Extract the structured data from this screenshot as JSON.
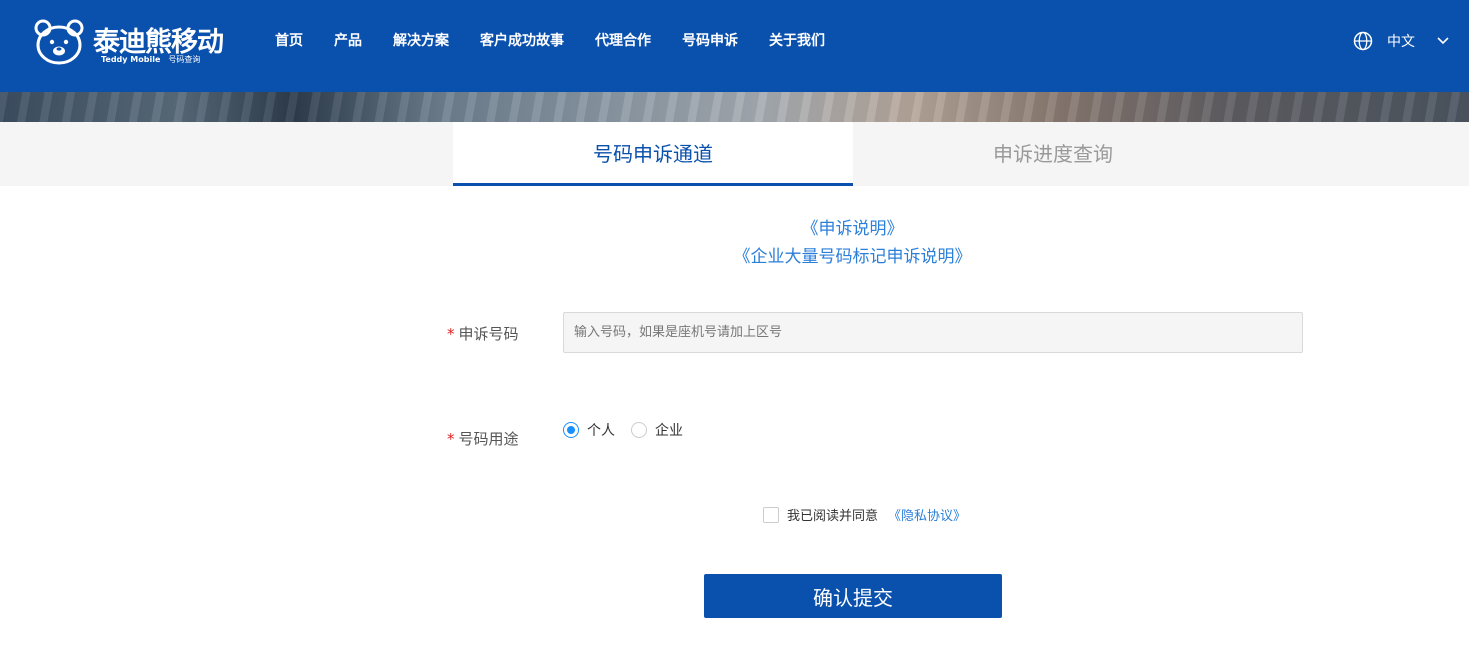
{
  "header": {
    "logo": {
      "cn_text": "泰迪熊移动",
      "en_text": "Teddy Mobile",
      "sub_text": "号码查询"
    },
    "nav": [
      {
        "label": "首页"
      },
      {
        "label": "产品"
      },
      {
        "label": "解决方案"
      },
      {
        "label": "客户成功故事"
      },
      {
        "label": "代理合作"
      },
      {
        "label": "号码申诉"
      },
      {
        "label": "关于我们"
      }
    ],
    "language": {
      "label": "中文",
      "icon": "globe-icon",
      "dropdown_icon": "chevron-down-icon"
    }
  },
  "tabs": [
    {
      "label": "号码申诉通道",
      "active": true
    },
    {
      "label": "申诉进度查询",
      "active": false
    }
  ],
  "links": {
    "appeal_instructions": "《申诉说明》",
    "enterprise_instructions": "《企业大量号码标记申诉说明》"
  },
  "form": {
    "number": {
      "label": "申诉号码",
      "required_mark": "*",
      "value": "",
      "placeholder": "输入号码，如果是座机号请加上区号"
    },
    "usage": {
      "label": "号码用途",
      "required_mark": "*",
      "options": [
        {
          "label": "个人",
          "checked": true
        },
        {
          "label": "企业",
          "checked": false
        }
      ]
    },
    "agreement": {
      "text": "我已阅读并同意",
      "link": "《隐私协议》",
      "checked": false
    },
    "submit_label": "确认提交"
  },
  "colors": {
    "brand": "#0a50ad",
    "link": "#2b7fd9",
    "required": "#e02020",
    "radio_active": "#1890ff"
  }
}
